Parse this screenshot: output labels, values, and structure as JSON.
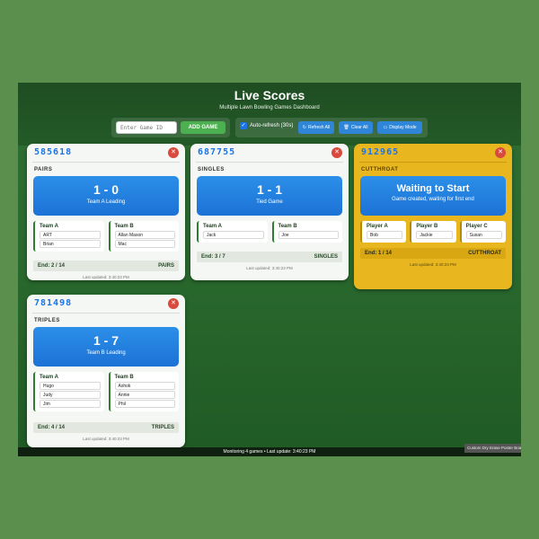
{
  "header": {
    "title": "Live Scores",
    "subtitle": "Multiple Lawn Bowling Games Dashboard"
  },
  "controls": {
    "game_id_placeholder": "Enter Game ID",
    "add_game_label": "ADD GAME",
    "auto_refresh_label": "Auto-refresh (30s)",
    "auto_refresh_checked": true,
    "refresh_all_label": "Refresh All",
    "clear_all_label": "Clear All",
    "display_mode_label": "Display Mode"
  },
  "games": [
    {
      "id": "585618",
      "type": "PAIRS",
      "score": "1 - 0",
      "status": "Team A Leading",
      "teams": [
        {
          "name": "Team A",
          "players": [
            "ART",
            "Brian"
          ]
        },
        {
          "name": "Team B",
          "players": [
            "Allan Mason",
            "Mac"
          ]
        }
      ],
      "end": "End: 2 / 14",
      "mode": "PAIRS",
      "updated": "Last updated: 3:40:23 PM"
    },
    {
      "id": "687755",
      "type": "SINGLES",
      "score": "1 - 1",
      "status": "Tied Game",
      "teams": [
        {
          "name": "Team A",
          "players": [
            "Jack"
          ]
        },
        {
          "name": "Team B",
          "players": [
            "Joe"
          ]
        }
      ],
      "end": "End: 3 / 7",
      "mode": "SINGLES",
      "updated": "Last updated: 3:40:23 PM"
    },
    {
      "id": "912965",
      "type": "CUTTHROAT",
      "wait_title": "Waiting to Start",
      "wait_sub": "Game created, waiting for first end",
      "teams": [
        {
          "name": "Player A",
          "players": [
            "Bob"
          ]
        },
        {
          "name": "Player B",
          "players": [
            "Jackie"
          ]
        },
        {
          "name": "Player C",
          "players": [
            "Susan"
          ]
        }
      ],
      "end": "End: 1 / 14",
      "mode": "CUTTHROAT",
      "updated": "Last updated: 3:40:23 PM"
    },
    {
      "id": "781498",
      "type": "TRIPLES",
      "score": "1 - 7",
      "status": "Team B Leading",
      "teams": [
        {
          "name": "Team A",
          "players": [
            "Hugo",
            "Judy",
            "Jim"
          ]
        },
        {
          "name": "Team B",
          "players": [
            "Ashok",
            "Annie",
            "Phil"
          ]
        }
      ],
      "end": "End: 4 / 14",
      "mode": "TRIPLES",
      "updated": "Last updated: 3:40:23 PM"
    }
  ],
  "footer": {
    "text": "Monitoring 4 games • Last update: 3:40:23 PM"
  },
  "tooltip": "Custom Dry Erase Poster Boards",
  "colors": {
    "accent_green": "#4caf50",
    "accent_blue": "#1a73e8",
    "cutthroat_yellow": "#e8b71f",
    "close_red": "#d94a3d"
  }
}
